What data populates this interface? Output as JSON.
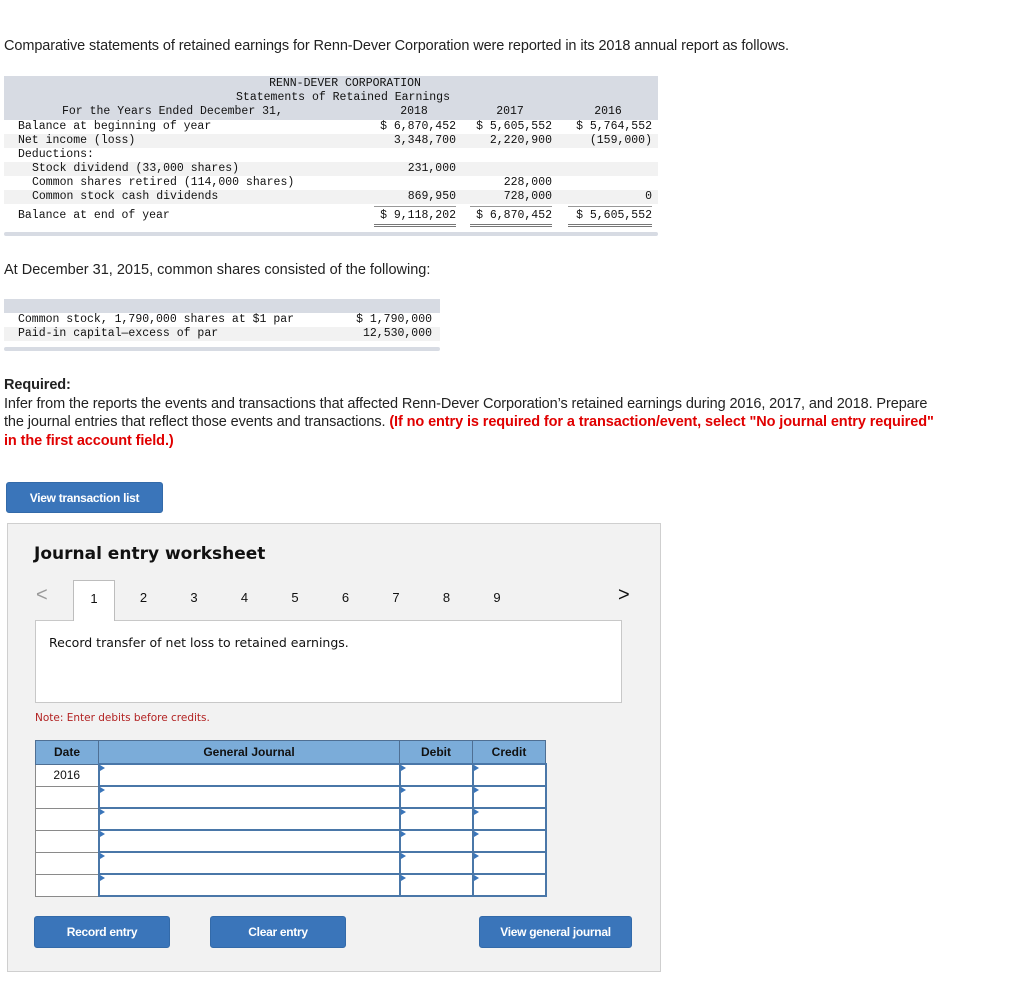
{
  "intro": "Comparative statements of retained earnings for Renn-Dever Corporation were reported in its 2018 annual report as follows.",
  "retained_earnings": {
    "company": "RENN-DEVER CORPORATION",
    "statement": "Statements of Retained Earnings",
    "period": "For the Years Ended December 31,",
    "years": [
      "2018",
      "2017",
      "2016"
    ],
    "rows": [
      {
        "label": "Balance at beginning of year",
        "indent": false,
        "values": [
          "$ 6,870,452",
          "$ 5,605,552",
          "$ 5,764,552"
        ]
      },
      {
        "label": "Net income (loss)",
        "indent": false,
        "values": [
          "3,348,700",
          "2,220,900",
          "(159,000)"
        ]
      },
      {
        "label": "Deductions:",
        "indent": false,
        "values": [
          "",
          "",
          ""
        ]
      },
      {
        "label": "Stock dividend (33,000 shares)",
        "indent": true,
        "values": [
          "231,000",
          "",
          ""
        ]
      },
      {
        "label": "Common shares retired (114,000 shares)",
        "indent": true,
        "values": [
          "",
          "228,000",
          ""
        ]
      },
      {
        "label": "Common stock cash dividends",
        "indent": true,
        "values": [
          "869,950",
          "728,000",
          "0"
        ]
      }
    ],
    "total": {
      "label": "Balance at end of year",
      "values": [
        "$ 9,118,202",
        "$ 6,870,452",
        "$ 5,605,552"
      ]
    }
  },
  "common_shares_intro": "At December 31, 2015, common shares consisted of the following:",
  "common_shares": [
    {
      "label": "Common stock, 1,790,000 shares at $1 par",
      "value": "$ 1,790,000"
    },
    {
      "label": "Paid-in capital—excess of par",
      "value": "12,530,000"
    }
  ],
  "required": {
    "title": "Required:",
    "text": "Infer from the reports the events and transactions that affected Renn-Dever Corporation’s retained earnings during 2016, 2017, and 2018. Prepare the journal entries that reflect those events and transactions. ",
    "red_text": "(If no entry is required for a transaction/event, select \"No journal entry required\" in the first account field.)"
  },
  "buttons": {
    "view_transaction_list": "View transaction list",
    "record_entry": "Record entry",
    "clear_entry": "Clear entry",
    "view_general_journal": "View general journal"
  },
  "worksheet": {
    "title": "Journal entry worksheet",
    "pages": [
      "1",
      "2",
      "3",
      "4",
      "5",
      "6",
      "7",
      "8",
      "9"
    ],
    "active_page": "1",
    "prev_icon": "<",
    "next_icon": ">",
    "description": "Record transfer of net loss to retained earnings.",
    "note": "Note: Enter debits before credits.",
    "columns": [
      "Date",
      "General Journal",
      "Debit",
      "Credit"
    ],
    "rows": [
      {
        "date": "2016",
        "account": "",
        "debit": "",
        "credit": ""
      },
      {
        "date": "",
        "account": "",
        "debit": "",
        "credit": ""
      },
      {
        "date": "",
        "account": "",
        "debit": "",
        "credit": ""
      },
      {
        "date": "",
        "account": "",
        "debit": "",
        "credit": ""
      },
      {
        "date": "",
        "account": "",
        "debit": "",
        "credit": ""
      },
      {
        "date": "",
        "account": "",
        "debit": "",
        "credit": ""
      }
    ]
  },
  "colors": {
    "button_blue": "#3a75ba",
    "table_header_blue": "#7bacd9",
    "statement_header_gray": "#d7dbe3",
    "instruction_red": "#e00000",
    "note_red": "#b22222"
  }
}
